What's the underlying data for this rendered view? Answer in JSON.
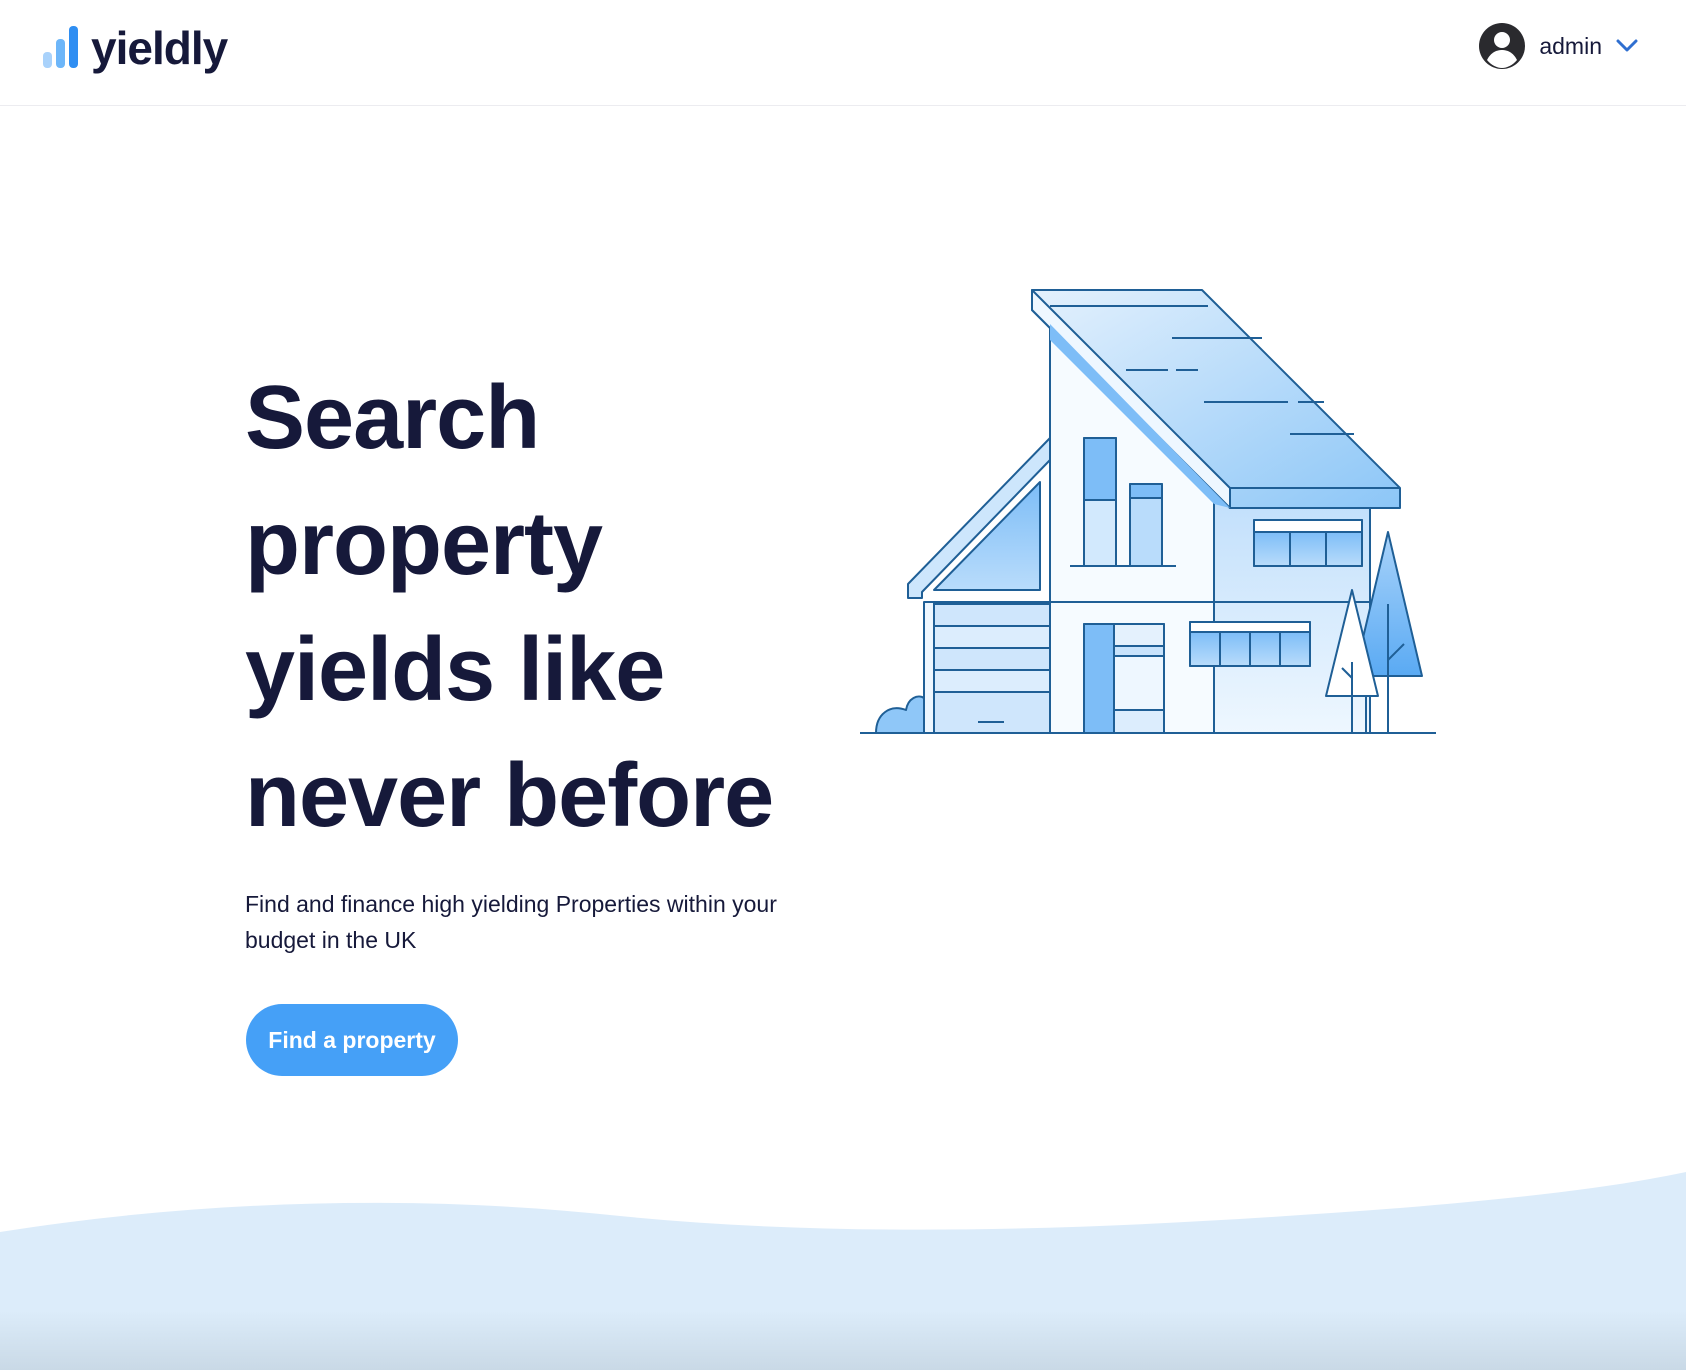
{
  "header": {
    "logo_text": "yieldly",
    "user_name": "admin"
  },
  "hero": {
    "title_lines": [
      "Search",
      "property",
      "yields like",
      "never before"
    ],
    "subtitle": "Find and finance high yielding Properties within your budget in the UK",
    "cta_label": "Find a property"
  },
  "icons": {
    "logo": "bar-chart-icon",
    "avatar": "user-circle-icon",
    "dropdown": "chevron-down-icon"
  },
  "colors": {
    "brand_blue": "#45a0f7",
    "text_dark": "#16193a",
    "wave": "#dcecfa",
    "outline": "#1f5f96"
  }
}
